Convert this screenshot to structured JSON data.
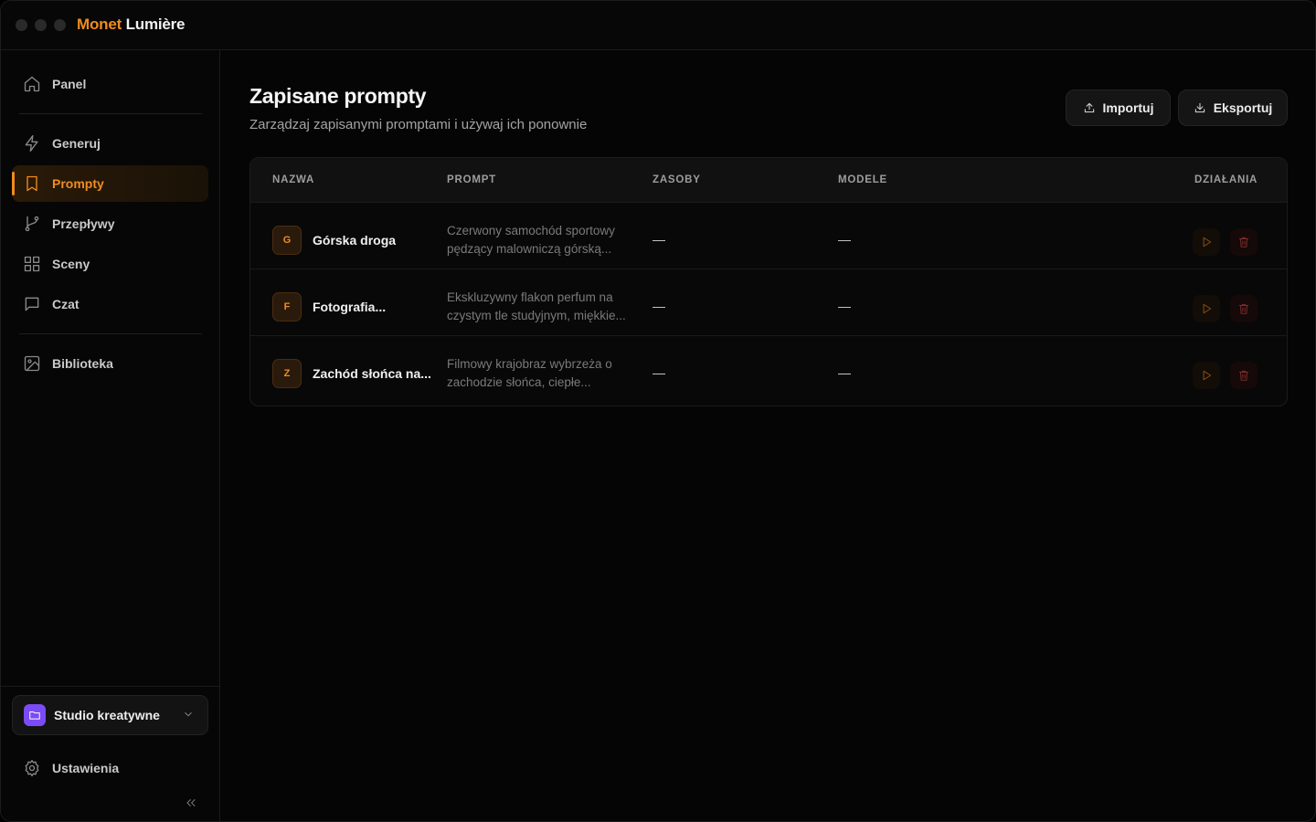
{
  "app": {
    "brand_part1": "Monet",
    "brand_part2": "Lumière",
    "accent_color": "#f08c1e"
  },
  "sidebar": {
    "items": [
      {
        "label": "Panel",
        "icon": "home-icon"
      },
      {
        "label": "Generuj",
        "icon": "lightning-icon"
      },
      {
        "label": "Prompty",
        "icon": "bookmark-icon",
        "active": true
      },
      {
        "label": "Przepływy",
        "icon": "git-branch-icon"
      },
      {
        "label": "Sceny",
        "icon": "grid-icon"
      },
      {
        "label": "Czat",
        "icon": "chat-icon"
      },
      {
        "label": "Biblioteka",
        "icon": "image-icon"
      }
    ],
    "workspace": {
      "label": "Studio kreatywne",
      "icon": "folder-icon"
    },
    "settings_label": "Ustawienia"
  },
  "main": {
    "title": "Zapisane prompty",
    "subtitle": "Zarządzaj zapisanymi promptami i używaj ich ponownie",
    "import_label": "Importuj",
    "export_label": "Eksportuj",
    "table": {
      "headers": {
        "name": "NAZWA",
        "prompt": "PROMPT",
        "assets": "ZASOBY",
        "models": "MODELE",
        "actions": "DZIAŁANIA"
      },
      "rows": [
        {
          "initial": "G",
          "name": "Górska droga",
          "prompt_line1": "Czerwony samochód sportowy",
          "prompt_line2": "pędzący malowniczą górską...",
          "assets": "—",
          "models": "—"
        },
        {
          "initial": "F",
          "name": "Fotografia...",
          "prompt_line1": "Ekskluzywny flakon perfum na",
          "prompt_line2": "czystym tle studyjnym, miękkie...",
          "assets": "—",
          "models": "—"
        },
        {
          "initial": "Z",
          "name": "Zachód słońca na...",
          "prompt_line1": "Filmowy krajobraz wybrzeża o",
          "prompt_line2": "zachodzie słońca, ciepłe...",
          "assets": "—",
          "models": "—"
        }
      ]
    }
  }
}
